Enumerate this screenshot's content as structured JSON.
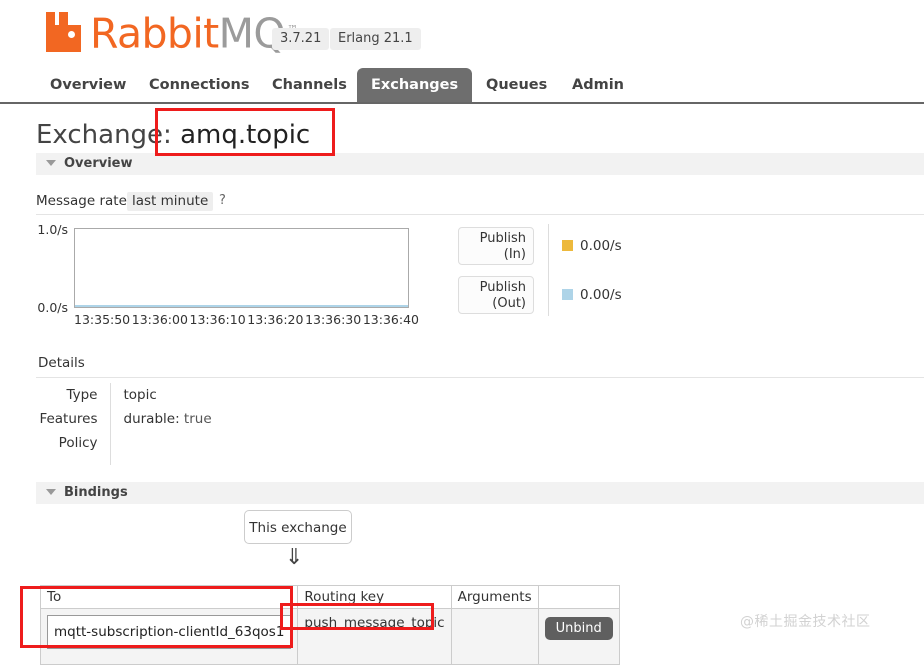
{
  "header": {
    "brand_rabbit": "Rabbit",
    "brand_mq": "MQ",
    "brand_tm": "™",
    "version": "3.7.21",
    "erlang": "Erlang 21.1",
    "logo_icon": "rabbitmq-logo-icon",
    "accent_color": "#f26722"
  },
  "nav": {
    "tabs": [
      {
        "label": "Overview",
        "active": false
      },
      {
        "label": "Connections",
        "active": false
      },
      {
        "label": "Channels",
        "active": false
      },
      {
        "label": "Exchanges",
        "active": true
      },
      {
        "label": "Queues",
        "active": false
      },
      {
        "label": "Admin",
        "active": false
      }
    ]
  },
  "page": {
    "title_prefix": "Exchange:",
    "title_name": "amq.topic"
  },
  "overview": {
    "section_label": "Overview",
    "rates_label": "Message rates",
    "rates_period": "last minute",
    "rates_help": "?"
  },
  "chart_data": {
    "type": "line",
    "title": "Message rates",
    "xlabel": "",
    "ylabel": "/s",
    "ylim": [
      0.0,
      1.0
    ],
    "ytick_labels": [
      "1.0/s",
      "0.0/s"
    ],
    "x": [
      "13:35:50",
      "13:36:00",
      "13:36:10",
      "13:36:20",
      "13:36:30",
      "13:36:40"
    ],
    "grid": false,
    "legend_position": "right",
    "series": [
      {
        "name": "Publish (In)",
        "color": "#edb93c",
        "rate": "0.00/s",
        "values": [
          0,
          0,
          0,
          0,
          0,
          0
        ]
      },
      {
        "name": "Publish (Out)",
        "color": "#aed4e8",
        "rate": "0.00/s",
        "values": [
          0,
          0,
          0,
          0,
          0,
          0
        ]
      }
    ]
  },
  "legend": {
    "publish_in_line1": "Publish",
    "publish_in_line2": "(In)",
    "publish_out_line1": "Publish",
    "publish_out_line2": "(Out)",
    "in_rate": "0.00/s",
    "out_rate": "0.00/s",
    "in_color": "#edb93c",
    "out_color": "#aed4e8"
  },
  "details": {
    "label": "Details",
    "type_label": "Type",
    "type_value": "topic",
    "features_label": "Features",
    "features_key": "durable:",
    "features_value": "true",
    "policy_label": "Policy",
    "policy_value": ""
  },
  "bindings": {
    "section_label": "Bindings",
    "this_exchange": "This exchange",
    "arrow_icon": "double-down-arrow-icon",
    "columns": [
      "To",
      "Routing key",
      "Arguments",
      ""
    ],
    "rows": [
      {
        "to": "mqtt-subscription-clientId_63qos1",
        "routing_key": "push_message_topic",
        "arguments": "",
        "action": "Unbind"
      }
    ]
  },
  "annotations": {
    "color": "#ee1c1c",
    "boxes": [
      "exchange-name",
      "binding-to",
      "binding-routing-key"
    ]
  },
  "watermark": {
    "text": "@稀土掘金技术社区"
  }
}
